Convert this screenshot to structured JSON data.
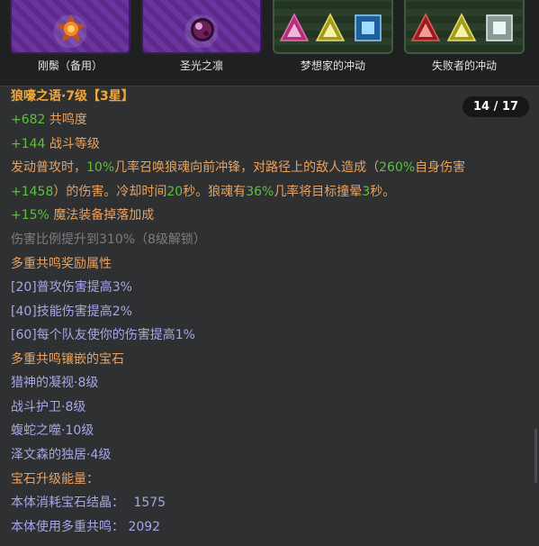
{
  "slots": [
    {
      "label": "刚鬃（备用）"
    },
    {
      "label": "圣光之凛"
    },
    {
      "label": "梦想家的冲动"
    },
    {
      "label": "失败者的冲动"
    }
  ],
  "tooltip": {
    "counter": "14 / 17",
    "title": "狼嚎之语·7级【3星】",
    "stat1_value": "+682",
    "stat1_label": "共鸣度",
    "stat2_value": "+144",
    "stat2_label": "战斗等级",
    "desc": {
      "p1": "发动普攻时，",
      "v1": "10%",
      "p2": "几率召唤狼魂向前冲锋，对路径上的敌人造成（",
      "v2": "260%",
      "p3": "自身伤害",
      "v3": "+1458",
      "p4": "）的伤害。冷却时间",
      "v4": "20",
      "p5": "秒。狼魂有",
      "v5": "36%",
      "p6": "几率将目标撞晕",
      "v6": "3",
      "p7": "秒。"
    },
    "drop_value": "+15%",
    "drop_label": "魔法装备掉落加成",
    "locked": "伤害比例提升到310%（8级解锁）",
    "bonus_header": "多重共鸣奖励属性",
    "bonuses": [
      "[20]普攻伤害提高3%",
      "[40]技能伤害提高2%",
      "[60]每个队友使你的伤害提高1%"
    ],
    "gems_header": "多重共鸣镶嵌的宝石",
    "gems": [
      "猎神的凝视·8级",
      "战斗护卫·8级",
      "蝮蛇之噬·10级",
      "泽文森的独居·4级"
    ],
    "energy_header": "宝石升级能量：",
    "energy1_label": "本体消耗宝石结晶：",
    "energy1_value": "1575",
    "energy2_label": "本体使用多重共鸣：",
    "energy2_value": "2092"
  },
  "colors": {
    "title": "#f3a83a",
    "green": "#5fbf3f",
    "orange": "#e7a262",
    "lavender": "#a8a6e8",
    "gray": "#7d7d80"
  }
}
